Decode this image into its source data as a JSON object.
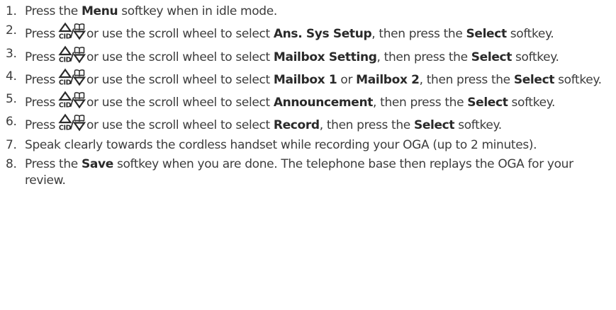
{
  "nav_icon": {
    "cid_label": "CID",
    "separator": "/"
  },
  "steps": [
    {
      "number": "1.",
      "parts": [
        {
          "text": "Press the "
        },
        {
          "text": "Menu",
          "bold": true
        },
        {
          "text": " softkey when in idle mode."
        }
      ]
    },
    {
      "number": "2.",
      "parts": [
        {
          "text": "Press"
        },
        {
          "icon": true
        },
        {
          "text": "or use the scroll wheel to select "
        },
        {
          "text": "Ans. Sys Setup",
          "bold": true
        },
        {
          "text": ", then press the "
        },
        {
          "text": "Select",
          "bold": true
        },
        {
          "text": " softkey."
        }
      ]
    },
    {
      "number": "3.",
      "parts": [
        {
          "text": "Press"
        },
        {
          "icon": true
        },
        {
          "text": "or use the scroll wheel to select "
        },
        {
          "text": "Mailbox Setting",
          "bold": true
        },
        {
          "text": ", then press the "
        },
        {
          "text": "Select",
          "bold": true
        },
        {
          "text": " softkey."
        }
      ]
    },
    {
      "number": "4.",
      "parts": [
        {
          "text": "Press"
        },
        {
          "icon": true
        },
        {
          "text": "or use the scroll wheel to select "
        },
        {
          "text": "Mailbox 1",
          "bold": true
        },
        {
          "text": " or "
        },
        {
          "text": "Mailbox 2",
          "bold": true
        },
        {
          "text": ", then press the "
        },
        {
          "text": "Select",
          "bold": true
        },
        {
          "text": " softkey."
        }
      ]
    },
    {
      "number": "5.",
      "parts": [
        {
          "text": "Press"
        },
        {
          "icon": true
        },
        {
          "text": "or use the scroll wheel to select "
        },
        {
          "text": "Announcement",
          "bold": true
        },
        {
          "text": ", then press the "
        },
        {
          "text": "Select",
          "bold": true
        },
        {
          "text": " softkey."
        }
      ]
    },
    {
      "number": "6.",
      "parts": [
        {
          "text": "Press"
        },
        {
          "icon": true
        },
        {
          "text": "or use the scroll wheel to select "
        },
        {
          "text": "Record",
          "bold": true
        },
        {
          "text": ", then press the "
        },
        {
          "text": "Select",
          "bold": true
        },
        {
          "text": " softkey."
        }
      ]
    },
    {
      "number": "7.",
      "parts": [
        {
          "text": "Speak clearly towards the cordless handset while recording your OGA (up to 2 minutes)."
        }
      ]
    },
    {
      "number": "8.",
      "parts": [
        {
          "text": "Press the "
        },
        {
          "text": "Save",
          "bold": true
        },
        {
          "text": " softkey when you are done. The telephone base then replays the OGA for your review."
        }
      ]
    }
  ]
}
